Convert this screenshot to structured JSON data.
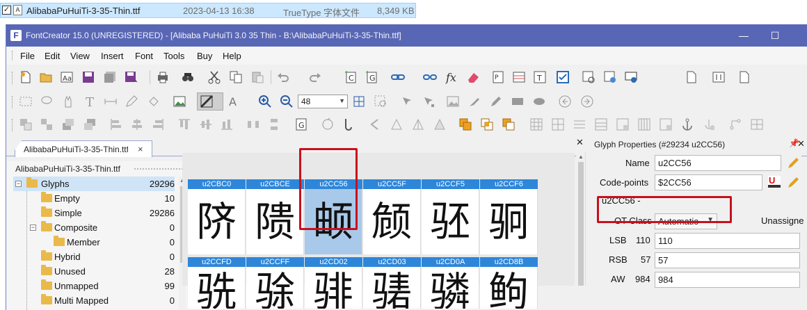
{
  "explorer_row": {
    "filename": "AlibabaPuHuiTi-3-35-Thin.ttf",
    "date": "2023-04-13 16:38",
    "type": "TrueType 字体文件",
    "size": "8,349 KB"
  },
  "window": {
    "title": "FontCreator 15.0 (UNREGISTERED) - [Alibaba PuHuiTi 3.0 35 Thin - B:\\AlibabaPuHuiTi-3-35-Thin.ttf]",
    "minimize": "—",
    "maximize": "☐"
  },
  "menu": [
    "File",
    "Edit",
    "View",
    "Insert",
    "Font",
    "Tools",
    "Buy",
    "Help"
  ],
  "toolbar": {
    "zoom_value": "48"
  },
  "doc_tab": {
    "label": "AlibabaPuHuiTi-3-35-Thin.ttf",
    "close": "×"
  },
  "left_panel": {
    "title": "AlibabaPuHuiTi-3-35-Thin.ttf",
    "tree": [
      {
        "name": "Glyphs",
        "count": "29296"
      },
      {
        "name": "Empty",
        "count": "10"
      },
      {
        "name": "Simple",
        "count": "29286"
      },
      {
        "name": "Composite",
        "count": "0"
      },
      {
        "name": "Member",
        "count": "0"
      },
      {
        "name": "Hybrid",
        "count": "0"
      },
      {
        "name": "Unused",
        "count": "28"
      },
      {
        "name": "Unmapped",
        "count": "99"
      },
      {
        "name": "Multi Mapped",
        "count": "0"
      }
    ]
  },
  "glyph_grid": {
    "row1": [
      {
        "code": "u2CBC0",
        "glyph": "𬯀"
      },
      {
        "code": "u2CBCE",
        "glyph": "𬯎"
      },
      {
        "code": "u2CC56",
        "glyph": "𬱖"
      },
      {
        "code": "u2CC5F",
        "glyph": "𬱟"
      },
      {
        "code": "u2CCF5",
        "glyph": "𬳵"
      },
      {
        "code": "u2CCF6",
        "glyph": "𬳶"
      }
    ],
    "row2": [
      {
        "code": "u2CCFD",
        "glyph": "𬳽"
      },
      {
        "code": "u2CCFF",
        "glyph": "𬳿"
      },
      {
        "code": "u2CD02",
        "glyph": "𬴂"
      },
      {
        "code": "u2CD03",
        "glyph": "𬴃"
      },
      {
        "code": "u2CD0A",
        "glyph": "𬴊"
      },
      {
        "code": "u2CD8B",
        "glyph": "𬶋"
      }
    ]
  },
  "glyph_properties": {
    "title": "Glyph Properties (#29234 u2CC56)",
    "name_label": "Name",
    "name_value": "u2CC56",
    "codepoints_label": "Code-points",
    "codepoints_value": "$2CC56",
    "codepoints_sub": "u2CC56 -",
    "ot_class_label": "OT Class",
    "ot_class_value": "Automatic",
    "ot_class_status": "Unassigne",
    "lsb_label": "LSB",
    "lsb_num": "110",
    "lsb_value": "110",
    "rsb_label": "RSB",
    "rsb_num": "57",
    "rsb_value": "57",
    "aw_label": "AW",
    "aw_num": "984",
    "aw_value": "984"
  },
  "colors": {
    "titlebar": "#5867b5",
    "glyph_header": "#2e86d9",
    "highlight": "#c8101d",
    "selected_cell": "#a9c9ea"
  }
}
